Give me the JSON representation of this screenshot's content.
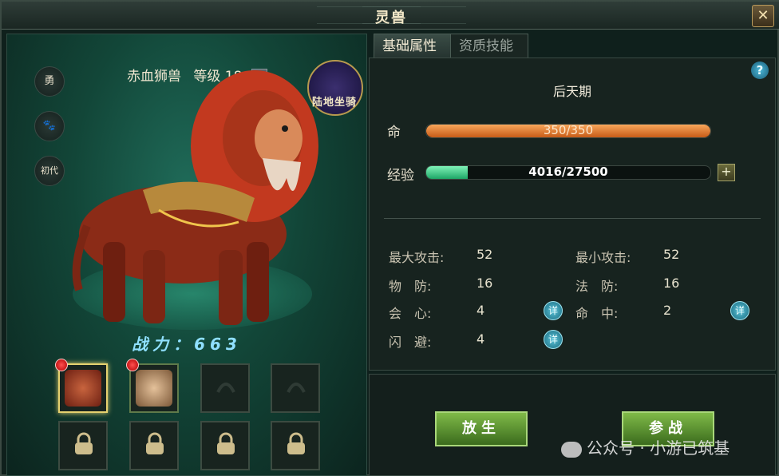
{
  "window": {
    "title": "灵兽",
    "close_label": "✕"
  },
  "left": {
    "side_icons": [
      "勇",
      "🐾",
      "初代"
    ],
    "pet_name": "赤血狮兽",
    "level_label": "等级 18",
    "dropdown_symbol": "▼",
    "mount_badge_text": "陆地坐骑",
    "power_label": "战力：663",
    "slots": [
      {
        "state": "selected",
        "portrait": "lion",
        "has_dot": true
      },
      {
        "state": "filled",
        "portrait": "monkey",
        "has_dot": true
      },
      {
        "state": "empty"
      },
      {
        "state": "empty"
      },
      {
        "state": "locked"
      },
      {
        "state": "locked"
      },
      {
        "state": "locked"
      },
      {
        "state": "locked"
      }
    ]
  },
  "tabs": [
    {
      "label": "基础属性",
      "active": true
    },
    {
      "label": "资质技能",
      "active": false
    }
  ],
  "attributes": {
    "stage": "后天期",
    "hp": {
      "label": "命",
      "text": "350/350",
      "fraction": 1.0
    },
    "exp": {
      "label": "经验",
      "text": "4016/27500",
      "fraction": 0.146
    },
    "stats": [
      {
        "label": "最大攻击:",
        "value": "52"
      },
      {
        "label": "最小攻击:",
        "value": "52"
      },
      {
        "label": "物　防:",
        "value": "16"
      },
      {
        "label": "法　防:",
        "value": "16"
      },
      {
        "label": "会　心:",
        "value": "4",
        "detail": true
      },
      {
        "label": "命　中:",
        "value": "2",
        "detail": true
      },
      {
        "label": "闪　避:",
        "value": "4",
        "detail": true
      }
    ],
    "detail_label": "详",
    "help_label": "?"
  },
  "buttons": {
    "release": "放生",
    "battle": "参战"
  },
  "watermark": "公众号 · 小游已筑基",
  "colors": {
    "accent": "#e5d16f",
    "hp": "#d9732a",
    "exp": "#2fc07a"
  }
}
